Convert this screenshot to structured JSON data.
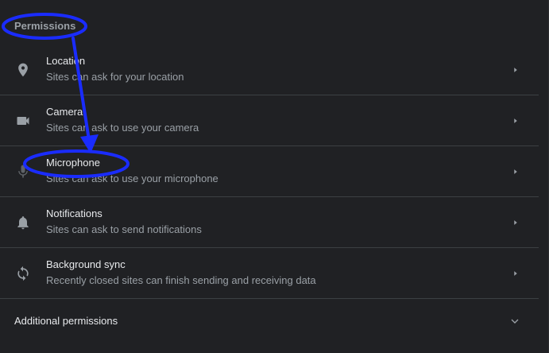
{
  "section_title": "Permissions",
  "items": [
    {
      "label": "Location",
      "description": "Sites can ask for your location",
      "icon": "location-pin-icon"
    },
    {
      "label": "Camera",
      "description": "Sites can ask to use your camera",
      "icon": "camera-icon"
    },
    {
      "label": "Microphone",
      "description": "Sites can ask to use your microphone",
      "icon": "microphone-icon"
    },
    {
      "label": "Notifications",
      "description": "Sites can ask to send notifications",
      "icon": "bell-icon"
    },
    {
      "label": "Background sync",
      "description": "Recently closed sites can finish sending and receiving data",
      "icon": "sync-icon"
    }
  ],
  "additional_permissions": "Additional permissions",
  "colors": {
    "background": "#202124",
    "text_primary": "#e8eaed",
    "text_secondary": "#9aa0a6",
    "divider": "#3c4043",
    "annotation": "#1a2cff"
  }
}
